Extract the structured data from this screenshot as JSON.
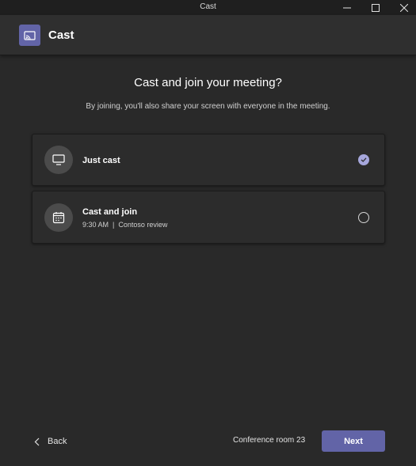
{
  "window": {
    "title": "Cast"
  },
  "header": {
    "title": "Cast",
    "icon": "cast-icon",
    "accent": "#6264a7"
  },
  "main": {
    "heading": "Cast and join your meeting?",
    "subheading": "By joining, you'll also share your screen with everyone in the meeting.",
    "options": [
      {
        "label": "Just cast",
        "icon": "monitor-icon",
        "selected": true
      },
      {
        "label": "Cast and join",
        "time": "9:30 AM",
        "separator": "|",
        "meeting": "Contoso review",
        "icon": "calendar-icon",
        "selected": false
      }
    ]
  },
  "footer": {
    "back_label": "Back",
    "room": "Conference room 23",
    "next_label": "Next"
  }
}
